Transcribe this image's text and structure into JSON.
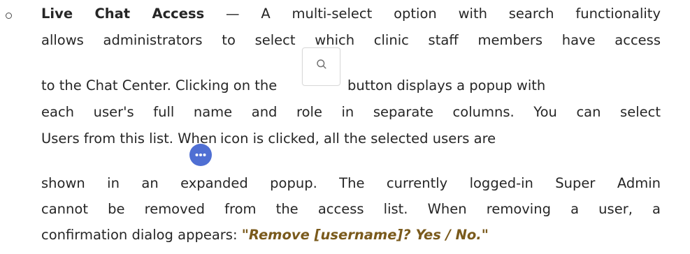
{
  "item": {
    "term": "Live Chat Access",
    "line1_rest": " — A multi-select option with search functionality",
    "line2": "allows administrators to select which clinic staff members have access",
    "line3_before": "to the Chat Center. Clicking on the",
    "line3_after": "button displays a popup with",
    "line4": "each user's full name and role in separate columns. You can select",
    "line5_before": "Users from this list. When",
    "line5_after": "icon is clicked, all the selected users are",
    "line6": "shown in an expanded popup. The currently logged-in Super Admin",
    "line7": "cannot be removed from the access list. When removing a user, a",
    "line8_before": "confirmation dialog appears: ",
    "line8_quote": "\"Remove [username]? Yes / No.\""
  },
  "icons": {
    "bullet": "hollow-circle-bullet",
    "search": "search-icon",
    "more": "ellipsis-icon"
  },
  "colors": {
    "text": "#262626",
    "quote": "#7a5a1c",
    "more_button": "#4f6fd3"
  }
}
